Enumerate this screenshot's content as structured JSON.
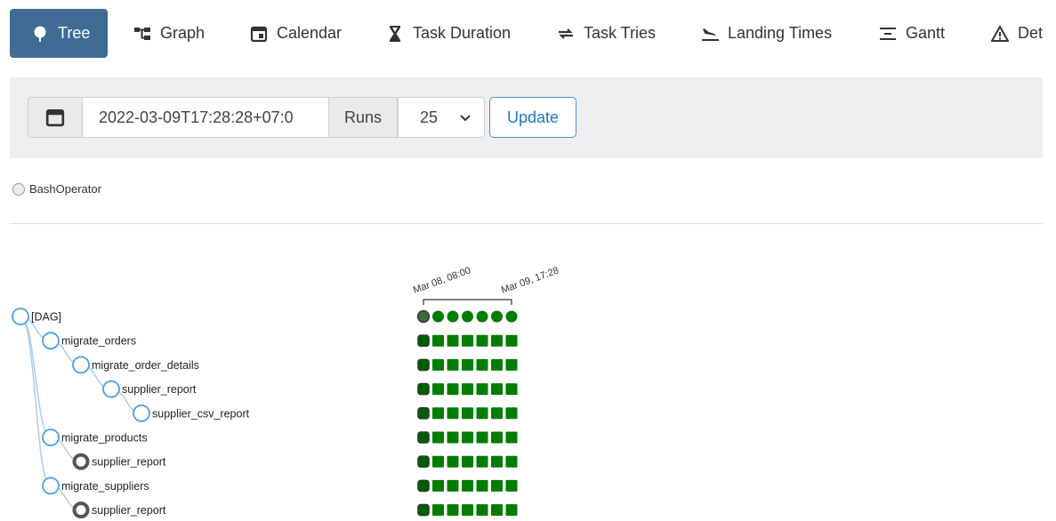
{
  "tabs": [
    {
      "label": "Tree",
      "icon": "tree-icon",
      "active": true
    },
    {
      "label": "Graph",
      "icon": "graph-icon"
    },
    {
      "label": "Calendar",
      "icon": "calendar-icon"
    },
    {
      "label": "Task Duration",
      "icon": "hourglass-icon"
    },
    {
      "label": "Task Tries",
      "icon": "retry-icon"
    },
    {
      "label": "Landing Times",
      "icon": "plane-landing-icon"
    },
    {
      "label": "Gantt",
      "icon": "gantt-icon"
    },
    {
      "label": "Det",
      "icon": "warning-icon"
    }
  ],
  "toolbar": {
    "date_value": "2022-03-09T17:28:28+07:0",
    "runs_label": "Runs",
    "runs_value": "25",
    "update_label": "Update"
  },
  "legend": {
    "operator": "BashOperator",
    "color": "#f0ede4"
  },
  "time_header": {
    "start": "Mar 08, 08:00",
    "end": "Mar 09, 17:28"
  },
  "tree": {
    "dag_label": "[DAG]",
    "tasks": [
      {
        "label": "migrate_orders",
        "depth": 1,
        "state": "normal"
      },
      {
        "label": "migrate_order_details",
        "depth": 2,
        "state": "normal"
      },
      {
        "label": "supplier_report",
        "depth": 3,
        "state": "normal"
      },
      {
        "label": "supplier_csv_report",
        "depth": 4,
        "state": "normal"
      },
      {
        "label": "migrate_products",
        "depth": 1,
        "state": "normal"
      },
      {
        "label": "supplier_report",
        "depth": 2,
        "state": "repeated"
      },
      {
        "label": "migrate_suppliers",
        "depth": 1,
        "state": "normal"
      },
      {
        "label": "supplier_report",
        "depth": 2,
        "state": "repeated"
      }
    ],
    "runs_shown": 7,
    "success_color": "#007c00",
    "node_stroke_color": "#4a9ee8",
    "link_color": "#a8cfe9"
  }
}
